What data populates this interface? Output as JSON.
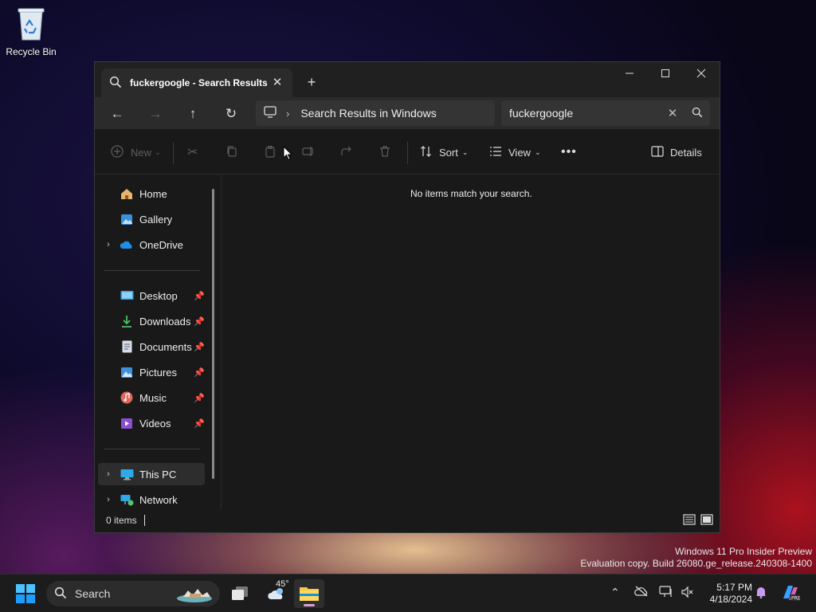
{
  "desktop": {
    "recycle_bin_label": "Recycle Bin"
  },
  "watermark": {
    "line1": "Windows 11 Pro Insider Preview",
    "line2": "Evaluation copy. Build 26080.ge_release.240308-1400"
  },
  "window": {
    "tab_title": "fuckergoogle - Search Results",
    "address_path": "Search Results in Windows",
    "search_query": "fuckergoogle",
    "commands": {
      "new_label": "New",
      "sort_label": "Sort",
      "view_label": "View",
      "details_label": "Details"
    },
    "sidebar": {
      "quick": [
        {
          "label": "Home",
          "icon": "home-icon"
        },
        {
          "label": "Gallery",
          "icon": "gallery-icon"
        },
        {
          "label": "OneDrive",
          "icon": "onedrive-icon"
        }
      ],
      "pinned": [
        {
          "label": "Desktop",
          "icon": "desktop-folder-icon"
        },
        {
          "label": "Downloads",
          "icon": "downloads-icon"
        },
        {
          "label": "Documents",
          "icon": "documents-icon"
        },
        {
          "label": "Pictures",
          "icon": "pictures-icon"
        },
        {
          "label": "Music",
          "icon": "music-icon"
        },
        {
          "label": "Videos",
          "icon": "videos-icon"
        }
      ],
      "devices": [
        {
          "label": "This PC",
          "icon": "this-pc-icon"
        },
        {
          "label": "Network",
          "icon": "network-icon"
        }
      ]
    },
    "empty_message": "No items match your search.",
    "status_count": "0 items"
  },
  "taskbar": {
    "search_label": "Search",
    "weather_temp": "45°",
    "time": "5:17 PM",
    "date": "4/18/2024"
  },
  "colors": {
    "accent": "#60cdff",
    "folder_yellow": "#f7c948"
  }
}
